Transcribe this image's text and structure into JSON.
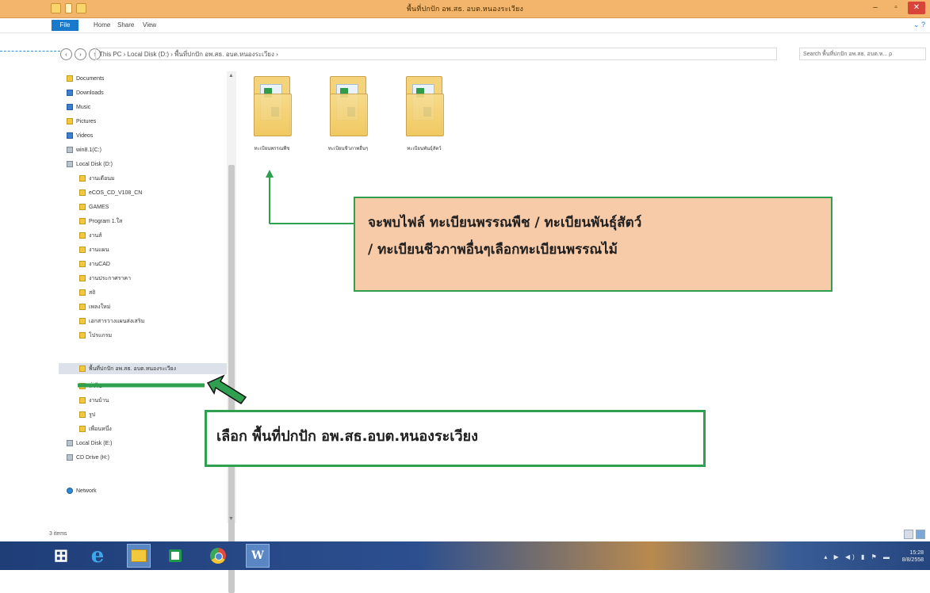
{
  "window": {
    "title": "พื้นที่ปกปัก อพ.สธ. อบต.หนองระเวียง",
    "controls": {
      "minimize": "–",
      "maximize": "▫",
      "close": "✕"
    }
  },
  "ribbon": {
    "file": "File",
    "home": "Home",
    "share": "Share",
    "view": "View"
  },
  "address": {
    "path": "This PC  ›  Local Disk (D:)  ›  พื้นที่ปกปัก อพ.สธ. อบต.หนองระเวียง  ›",
    "search_placeholder": "Search พื้นที่ปกปัก อพ.สธ. อบต.ห... ρ"
  },
  "nav_pane": {
    "top_items": [
      "Documents",
      "Downloads",
      "Music",
      "Pictures",
      "Videos",
      "win8.1(C:)"
    ],
    "local_disk": "Local Disk (D:)",
    "sub_folders_before": [
      "งานเดือนม",
      "eCOS_CD_V108_CN",
      "GAMES",
      "Program 1.ใส",
      "งานส์",
      "งานแผน",
      "งานCAD",
      "งานประกาศราคา",
      "สถิ",
      "เพลงใหม่",
      "เอกสารวางแผนส่งเสริม",
      "โปรแกรม"
    ],
    "selected_folder": "พื้นที่ปกปัก อพ.สธ. อบต.หนองระเวียง",
    "sub_folders_after": [
      "ทั่วไป",
      "งานบ้าน",
      "รูป",
      "เพื่อนหนึ่ง"
    ],
    "drives_after": [
      "Local Disk (E:)",
      "CD Drive (H:)"
    ],
    "network": "Network"
  },
  "content": {
    "folders": [
      {
        "name": "ทะเบียนพรรณพืช"
      },
      {
        "name": "ทะเบียนชีวภาพอื่นๆ"
      },
      {
        "name": "ทะเบียนพันธุ์สัตว์"
      }
    ]
  },
  "annotations": {
    "box1_line1": "จะพบไฟล์ ทะเบียนพรรณพืช / ทะเบียนพันธุ์สัตว์",
    "box1_line2": "/ ทะเบียนชีวภาพอื่นๆเลือกทะเบียนพรรณไม้",
    "box2": "เลือก พื้นที่ปกปัก  อพ.สธ.อบต.หนองระเวียง"
  },
  "status": {
    "item_count": "3 items"
  },
  "taskbar": {
    "tray_time": "15:28",
    "tray_date": "8/8/2558"
  },
  "colors": {
    "annotation_green": "#2ea04f",
    "annotation_fill": "#f8cba8",
    "titlebar": "#f2b56b",
    "file_tab": "#1979ca"
  }
}
